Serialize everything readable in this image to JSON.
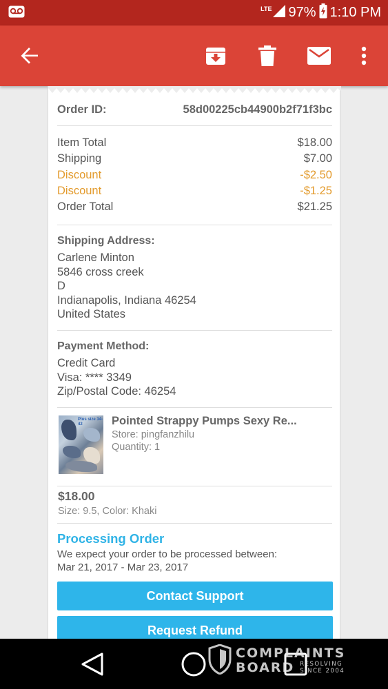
{
  "status_bar": {
    "network": "LTE",
    "battery": "97%",
    "time": "1:10 PM"
  },
  "app_bar": {
    "icons": [
      "back-arrow-icon",
      "archive-icon",
      "delete-icon",
      "mail-icon",
      "more-vert-icon"
    ]
  },
  "order": {
    "id_label": "Order ID:",
    "id_value": "58d00225cb44900b2f71f3bc",
    "summary": [
      {
        "label": "Item Total",
        "value": "$18.00",
        "highlight": false
      },
      {
        "label": "Shipping",
        "value": "$7.00",
        "highlight": false
      },
      {
        "label": "Discount",
        "value": "-$2.50",
        "highlight": true
      },
      {
        "label": "Discount",
        "value": "-$1.25",
        "highlight": true
      },
      {
        "label": "Order Total",
        "value": "$21.25",
        "highlight": false
      }
    ],
    "shipping": {
      "heading": "Shipping Address:",
      "lines": [
        "Carlene Minton",
        "5846 cross creek",
        "D",
        "Indianapolis, Indiana 46254",
        "United States"
      ]
    },
    "payment": {
      "heading": "Payment Method:",
      "lines": [
        "Credit Card",
        "Visa: **** 3349",
        "Zip/Postal Code: 46254"
      ]
    },
    "product": {
      "title": "Pointed Strappy Pumps Sexy Re...",
      "store": "Store: pingfanzhilu",
      "quantity": "Quantity: 1",
      "thumb_text": "Plus size 34-42",
      "price": "$18.00",
      "variant": "Size: 9.5, Color: Khaki"
    },
    "status": {
      "title": "Processing Order",
      "line1": "We expect your order to be processed between:",
      "line2": "Mar 21, 2017 - Mar 23, 2017"
    },
    "buttons": {
      "contact": "Contact Support",
      "refund": "Request Refund"
    }
  },
  "watermark": {
    "line1": "COMPLAINTS",
    "line2": "BOARD",
    "tag1": "RESOLVING",
    "tag2": "SINCE 2004"
  },
  "colors": {
    "status_bar": "#b3261e",
    "app_bar": "#db4437",
    "discount": "#e39b2d",
    "accent": "#2fb3e6",
    "button": "#2eb5ea"
  }
}
